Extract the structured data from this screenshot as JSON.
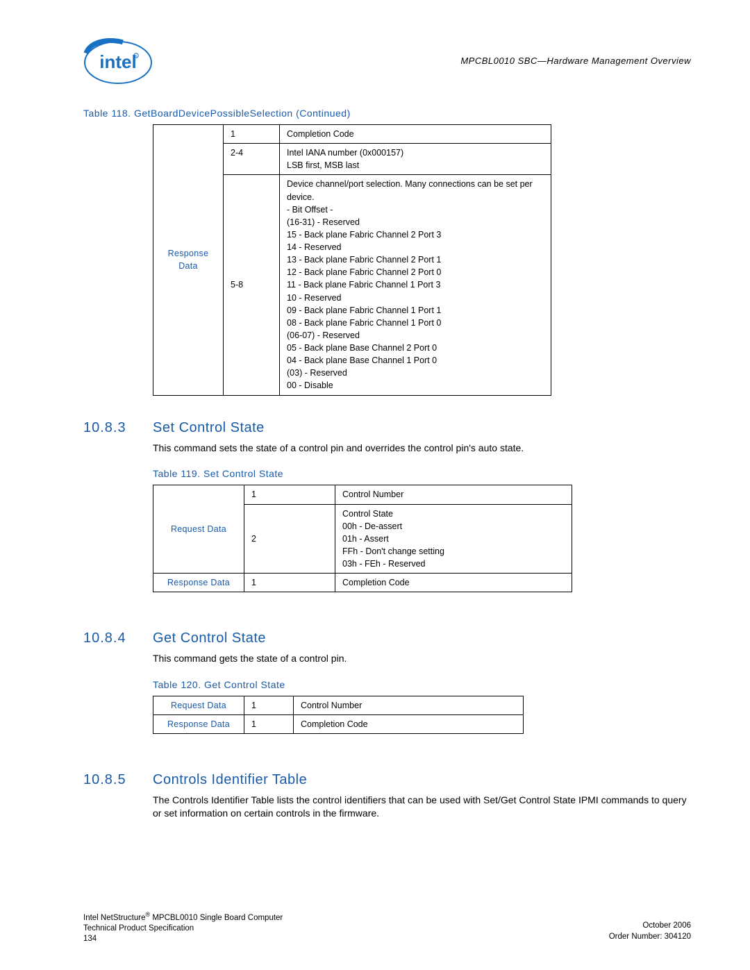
{
  "header": {
    "doc_title": "MPCBL0010 SBC—Hardware Management Overview",
    "logo_alt": "intel-logo"
  },
  "table118": {
    "caption": "Table 118.   GetBoardDevicePossibleSelection (Continued)",
    "rowlabel": "Response\nData",
    "rows": [
      {
        "byte": "1",
        "desc": "Completion Code"
      },
      {
        "byte": "2-4",
        "desc": "Intel IANA number (0x000157)\nLSB first, MSB last"
      },
      {
        "byte": "5-8",
        "desc": "Device channel/port selection. Many connections can be set per device.\n- Bit Offset -\n(16-31) - Reserved\n15 - Back plane Fabric Channel 2 Port 3\n14 - Reserved\n13 - Back plane Fabric Channel 2 Port 1\n12 - Back plane Fabric Channel 2 Port 0\n11 - Back plane Fabric Channel 1 Port 3\n10 - Reserved\n09 - Back plane Fabric Channel 1 Port 1\n08 - Back plane Fabric Channel 1 Port 0\n(06-07) - Reserved\n05 - Back plane Base Channel 2 Port 0\n04 - Back plane Base Channel 1 Port 0\n(03) - Reserved\n00 - Disable"
      }
    ]
  },
  "section1083": {
    "num": "10.8.3",
    "title": "Set Control State",
    "body": "This command sets the state of a control pin and overrides the control pin's auto state."
  },
  "table119": {
    "caption": "Table 119.   Set Control State",
    "req_label": "Request Data",
    "resp_label": "Response Data",
    "req_rows": [
      {
        "byte": "1",
        "desc": "Control Number"
      },
      {
        "byte": "2",
        "desc": "Control State\n00h - De-assert\n01h - Assert\nFFh - Don't change setting\n03h - FEh - Reserved"
      }
    ],
    "resp_row": {
      "byte": "1",
      "desc": "Completion Code"
    }
  },
  "section1084": {
    "num": "10.8.4",
    "title": "Get Control State",
    "body": "This command gets the state of a control pin."
  },
  "table120": {
    "caption": "Table 120.   Get Control State",
    "req_label": "Request Data",
    "resp_label": "Response Data",
    "req_row": {
      "byte": "1",
      "desc": "Control Number"
    },
    "resp_row": {
      "byte": "1",
      "desc": "Completion Code"
    }
  },
  "section1085": {
    "num": "10.8.5",
    "title": "Controls Identifier Table",
    "body": "The Controls Identifier Table lists the control identifiers that can be used with Set/Get Control State IPMI commands to query or set information on certain controls in the firmware."
  },
  "footer": {
    "left_line1_a": "Intel NetStructure",
    "left_line1_b": " MPCBL0010 Single Board Computer",
    "left_line2": "Technical Product Specification",
    "left_line3": "134",
    "right_line1": "October 2006",
    "right_line2": "Order Number: 304120"
  }
}
